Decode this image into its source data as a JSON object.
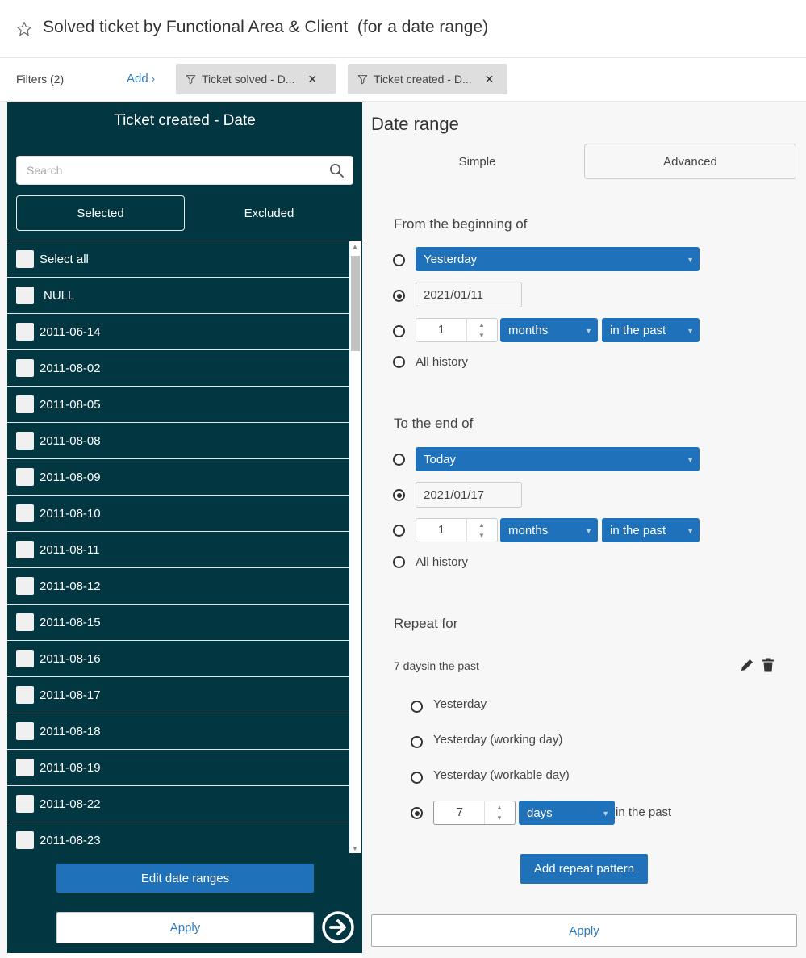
{
  "header": {
    "title": "Solved ticket by Functional Area & Client  (for a date range)"
  },
  "filters": {
    "label": "Filters (2)",
    "add_label": "Add",
    "chips": [
      {
        "label": "Ticket solved - D..."
      },
      {
        "label": "Ticket created - D..."
      }
    ]
  },
  "left_panel": {
    "title": "Ticket created - Date",
    "search_placeholder": "Search",
    "tabs": {
      "selected": "Selected",
      "excluded": "Excluded"
    },
    "items": [
      "Select all",
      "NULL",
      "2011-06-14",
      "2011-08-02",
      "2011-08-05",
      "2011-08-08",
      "2011-08-09",
      "2011-08-10",
      "2011-08-11",
      "2011-08-12",
      "2011-08-15",
      "2011-08-16",
      "2011-08-17",
      "2011-08-18",
      "2011-08-19",
      "2011-08-22",
      "2011-08-23"
    ],
    "edit_label": "Edit date ranges",
    "apply_label": "Apply"
  },
  "right_panel": {
    "title": "Date range",
    "tabs": {
      "simple": "Simple",
      "advanced": "Advanced"
    },
    "from": {
      "heading": "From the beginning of",
      "preset": "Yesterday",
      "date": "2021/01/11",
      "count": "1",
      "unit": "months",
      "direction": "in the past",
      "all_history": "All history"
    },
    "to": {
      "heading": "To the end of",
      "preset": "Today",
      "date": "2021/01/17",
      "count": "1",
      "unit": "months",
      "direction": "in the past",
      "all_history": "All history"
    },
    "repeat": {
      "heading": "Repeat for",
      "summary": "7 daysin the past",
      "options": [
        "Yesterday",
        "Yesterday (working day)",
        "Yesterday (workable day)"
      ],
      "count": "7",
      "unit": "days",
      "suffix": "in the past",
      "add_label": "Add repeat pattern"
    },
    "apply_label": "Apply"
  },
  "colors": {
    "panel_dark": "#023641",
    "accent_blue": "#1f72b9",
    "link_blue": "#2f7cc0"
  }
}
